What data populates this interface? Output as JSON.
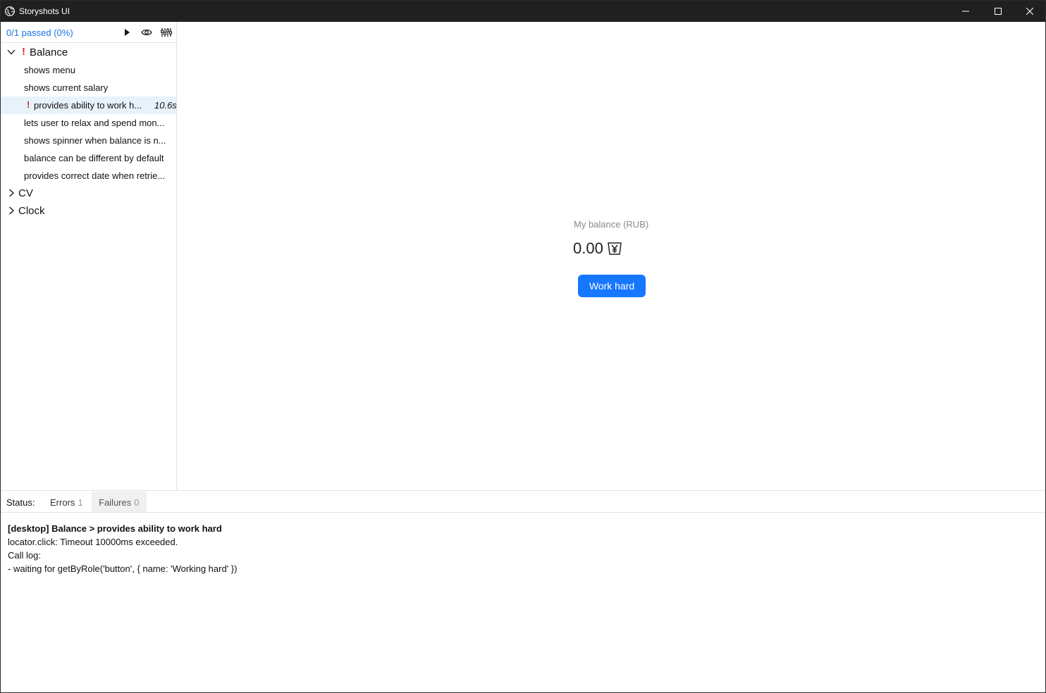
{
  "window": {
    "title": "Storyshots UI"
  },
  "sidebar": {
    "summary": "0/1 passed (0%)",
    "icons": [
      "play-icon",
      "eye-icon",
      "sliders-icon"
    ],
    "groups": [
      {
        "label": "Balance",
        "expanded": true,
        "has_error": true,
        "error_mark": "!",
        "stories": [
          {
            "label": "shows menu"
          },
          {
            "label": "shows current salary"
          },
          {
            "label": "provides ability to work h...",
            "selected": true,
            "error_mark": "!",
            "time": "10.6s"
          },
          {
            "label": "lets user to relax and spend mon..."
          },
          {
            "label": "shows spinner when balance is n..."
          },
          {
            "label": "balance can be different by default"
          },
          {
            "label": "provides correct date when retrie..."
          }
        ]
      },
      {
        "label": "CV",
        "expanded": false
      },
      {
        "label": "Clock",
        "expanded": false
      }
    ]
  },
  "preview": {
    "caption": "My balance (RUB)",
    "value": "0.00",
    "currency_icon": "yen-wallet-icon",
    "button_label": "Work hard",
    "button_color": "#1677ff"
  },
  "status": {
    "label": "Status:",
    "tabs": [
      {
        "label": "Errors",
        "count": "1"
      },
      {
        "label": "Failures",
        "count": "0"
      }
    ]
  },
  "log": {
    "title": "[desktop] Balance > provides ability to work hard",
    "lines": [
      "locator.click: Timeout 10000ms exceeded.",
      "Call log:",
      "- waiting for getByRole('button', { name: 'Working hard' })"
    ]
  },
  "colors": {
    "titlebar": "#202020",
    "accent": "#1a73e8",
    "error": "#e02828",
    "selected_row": "#e8f2fb"
  }
}
